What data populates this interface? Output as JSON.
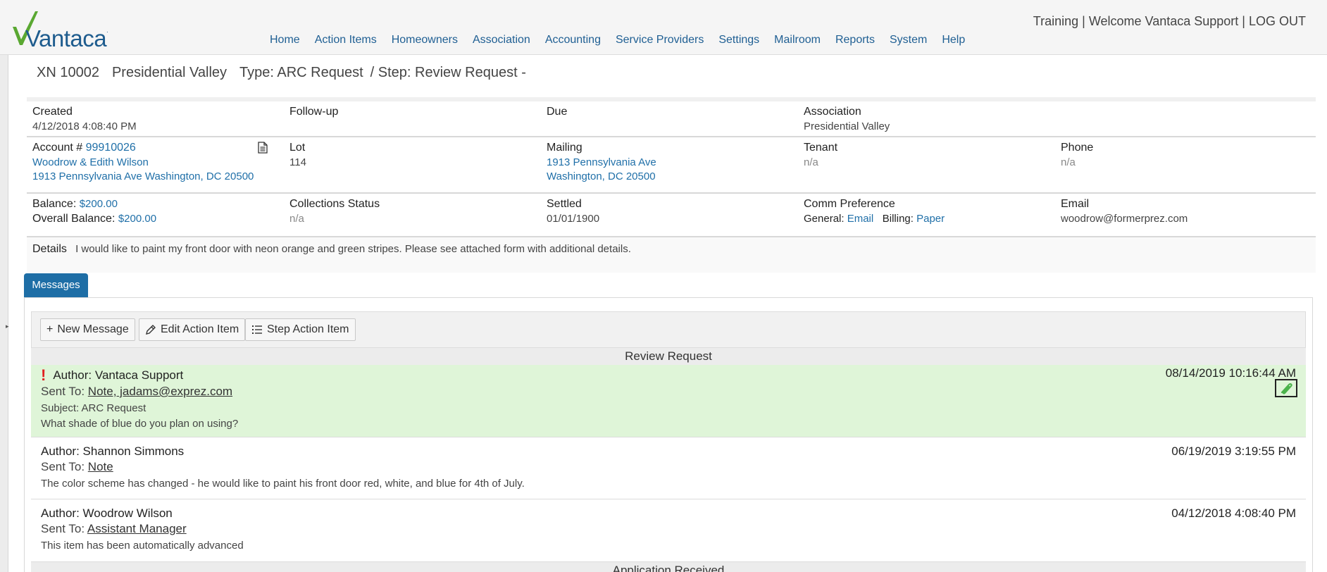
{
  "logo": {
    "text": "Vantaca",
    "mark": "v-checkmark-icon"
  },
  "nav": [
    "Home",
    "Action Items",
    "Homeowners",
    "Association",
    "Accounting",
    "Service Providers",
    "Settings",
    "Mailroom",
    "Reports",
    "System",
    "Help"
  ],
  "topright": {
    "env": "Training",
    "sep1": " | ",
    "welcome": "Welcome Vantaca Support",
    "sep2": " | ",
    "logout": "LOG OUT"
  },
  "title": {
    "id": "XN 10002",
    "association": "Presidential Valley",
    "type": "Type: ARC Request",
    "step": "/ Step: Review Request -"
  },
  "info": {
    "created_label": "Created",
    "created_value": "4/12/2018 4:08:40 PM",
    "followup_label": "Follow-up",
    "due_label": "Due",
    "association_label": "Association",
    "association_value": "Presidential Valley",
    "account_label": "Account #",
    "account_number": "99910026",
    "account_owner": "Woodrow & Edith Wilson",
    "account_address": "1913 Pennsylvania Ave Washington, DC 20500",
    "lot_label": "Lot",
    "lot_value": "114",
    "mailing_label": "Mailing",
    "mailing_line1": "1913 Pennsylvania Ave",
    "mailing_line2": "Washington, DC 20500",
    "tenant_label": "Tenant",
    "tenant_value": "n/a",
    "phone_label": "Phone",
    "phone_value": "n/a",
    "balance_label": "Balance:",
    "balance_value": "$200.00",
    "overall_label": "Overall Balance:",
    "overall_value": "$200.00",
    "collections_label": "Collections Status",
    "collections_value": "n/a",
    "settled_label": "Settled",
    "settled_value": "01/01/1900",
    "comm_label": "Comm Preference",
    "comm_general_label": "General:",
    "comm_general_value": "Email",
    "comm_billing_label": "Billing:",
    "comm_billing_value": "Paper",
    "email_label": "Email",
    "email_value": "woodrow@formerprez.com",
    "details_label": "Details",
    "details_value": "I would like to paint my front door with neon orange and green stripes. Please see attached form with additional details."
  },
  "tabs": {
    "messages": "Messages"
  },
  "toolbar": {
    "new_message": "New Message",
    "edit_action_item": "Edit Action Item",
    "step_action_item": "Step Action Item"
  },
  "sections": {
    "review_request": "Review Request",
    "application_received": "Application Received"
  },
  "messages": [
    {
      "author": "Author: Vantaca Support",
      "date": "08/14/2019 10:16:44 AM",
      "sent_label": "Sent To: ",
      "sent_to": "Note, jadams@exprez.com",
      "subject": "Subject: ARC Request",
      "body": "What shade of blue do you plan on using?",
      "urgent": true,
      "attachment": true
    },
    {
      "author": "Author: Shannon Simmons",
      "date": "06/19/2019 3:19:55 PM",
      "sent_label": "Sent To: ",
      "sent_to": "Note",
      "body": "The color scheme has changed - he would like to paint his front door red, white, and blue for 4th of July."
    },
    {
      "author": "Author: Woodrow Wilson",
      "date": "04/12/2018 4:08:40 PM",
      "sent_label": "Sent To: ",
      "sent_to": "Assistant Manager",
      "body": "This item has been automatically advanced"
    }
  ],
  "colors": {
    "brand_blue": "#1e6ea6",
    "link": "#1f6fa8",
    "highlight": "#dff5d8",
    "urgent": "#e02020",
    "logo_green": "#5aa832"
  }
}
